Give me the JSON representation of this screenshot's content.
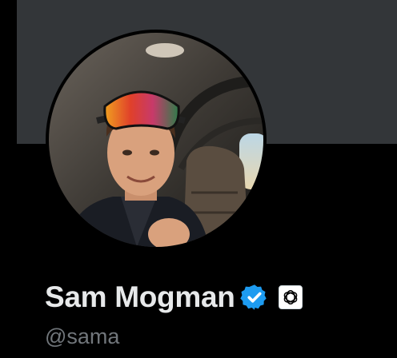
{
  "profile": {
    "display_name": "Sam Mogman",
    "handle": "@sama",
    "verified_badge_icon": "verified-check-icon",
    "affiliation_badge_icon": "openai-logo-icon"
  },
  "colors": {
    "banner": "#333639",
    "background": "#000000",
    "name_text": "#e7e9ea",
    "handle_text": "#71767b",
    "verified_blue": "#1d9bf0"
  }
}
